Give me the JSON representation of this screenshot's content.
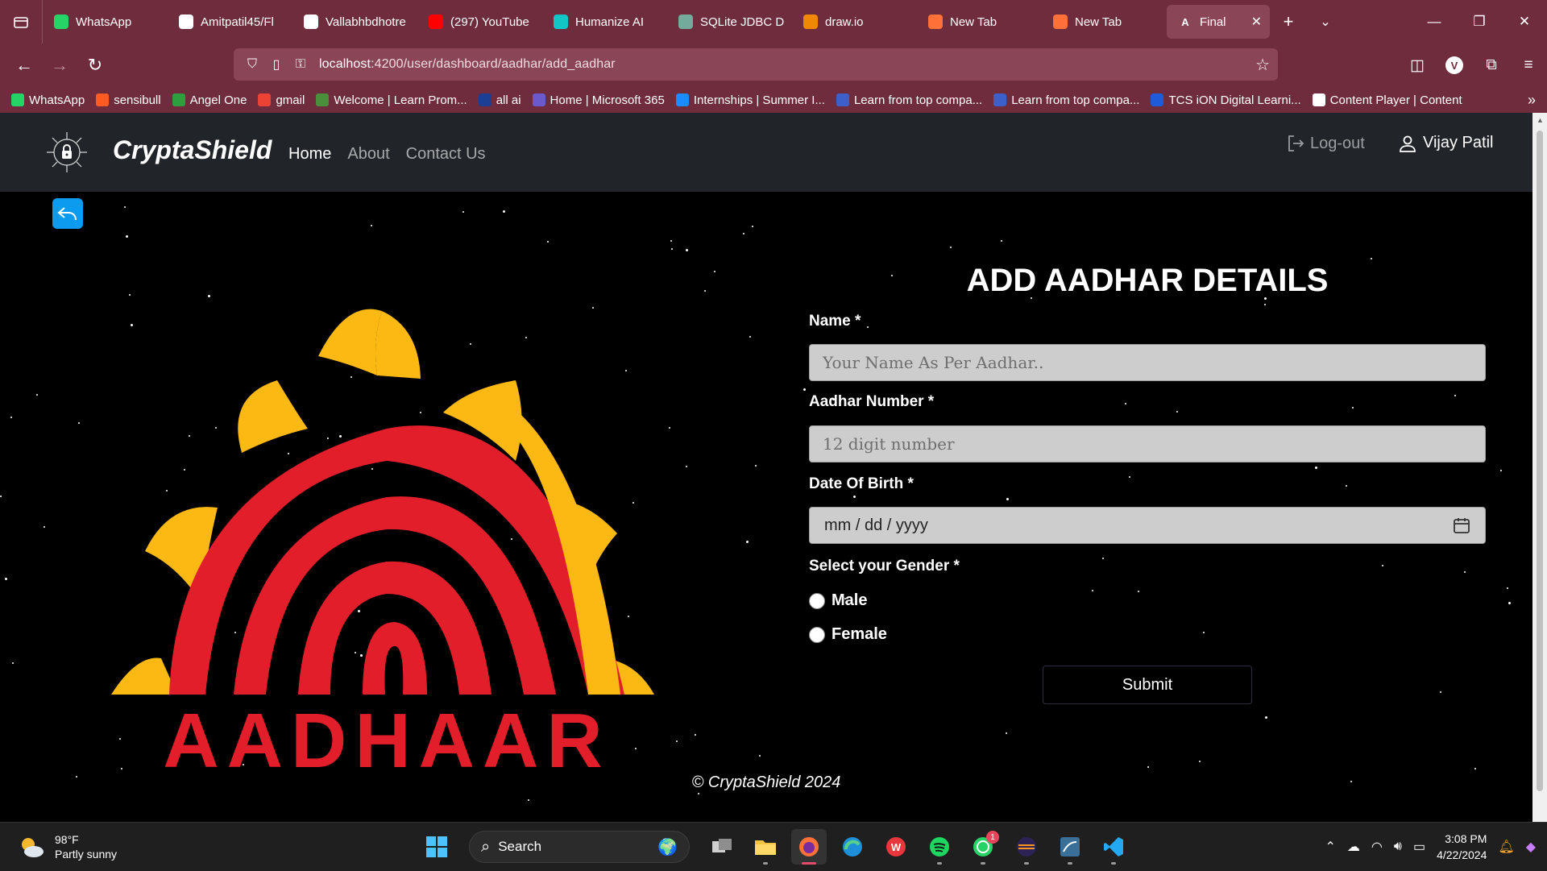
{
  "browser": {
    "tabs": [
      {
        "title": "WhatsApp",
        "icon": "whatsapp-icon",
        "color": "#25d366"
      },
      {
        "title": "Amitpatil45/Fl",
        "icon": "github-icon",
        "color": "#ffffff"
      },
      {
        "title": "Vallabhbdhotre",
        "icon": "github-icon",
        "color": "#ffffff"
      },
      {
        "title": "(297) YouTube",
        "icon": "youtube-icon",
        "color": "#ff0000"
      },
      {
        "title": "Humanize AI",
        "icon": "humanize-ai-icon",
        "color": "#12c6c6"
      },
      {
        "title": "SQLite JDBC Dr",
        "icon": "chatgpt-icon",
        "color": "#74aa9c"
      },
      {
        "title": "draw.io",
        "icon": "drawio-icon",
        "color": "#f08705"
      },
      {
        "title": "New Tab",
        "icon": "firefox-icon",
        "color": "#ff7139"
      },
      {
        "title": "New Tab",
        "icon": "firefox-icon",
        "color": "#ff7139"
      }
    ],
    "active_tab": {
      "title": "Final",
      "icon": "angular-icon"
    },
    "url_host": "localhost",
    "url_path": ":4200/user/dashboard/aadhar/add_aadhar",
    "profile_initial": "V",
    "bookmarks": [
      {
        "label": "WhatsApp",
        "icon": "whatsapp-icon",
        "color": "#25d366"
      },
      {
        "label": "sensibull",
        "icon": "sensibull-icon",
        "color": "#ff5a1f"
      },
      {
        "label": "Angel One",
        "icon": "angel-one-icon",
        "color": "#2e9f3f"
      },
      {
        "label": "gmail",
        "icon": "gmail-icon",
        "color": "#ea4335"
      },
      {
        "label": "Welcome | Learn Prom...",
        "icon": "globe-icon",
        "color": "#4a8f3c"
      },
      {
        "label": "all ai",
        "icon": "all-ai-icon",
        "color": "#1c3f94"
      },
      {
        "label": "Home | Microsoft 365",
        "icon": "microsoft365-icon",
        "color": "#6a5acd"
      },
      {
        "label": "Internships | Summer I...",
        "icon": "internshala-icon",
        "color": "#1a8cff"
      },
      {
        "label": "Learn from top compa...",
        "icon": "shield-icon",
        "color": "#3d5fc9"
      },
      {
        "label": "Learn from top compa...",
        "icon": "shield-icon",
        "color": "#3d5fc9"
      },
      {
        "label": "TCS iON Digital Learni...",
        "icon": "tcs-icon",
        "color": "#1e5bd8"
      },
      {
        "label": "Content Player | Content",
        "icon": "globe-icon",
        "color": "#ffffff"
      }
    ]
  },
  "site": {
    "brand": "CryptaShield",
    "menu": {
      "home": "Home",
      "about": "About",
      "contact": "Contact Us"
    },
    "logout": "Log-out",
    "user_name": "Vijay Patil",
    "logo_text": "AADHAAR",
    "logo_colors": {
      "sun": "#fcb813",
      "fingerprint": "#e31e2b"
    }
  },
  "form": {
    "title": "ADD AADHAR DETAILS",
    "name_label": "Name *",
    "name_placeholder": "Your Name As Per Aadhar..",
    "aadhar_label": "Aadhar Number *",
    "aadhar_placeholder": "12 digit number",
    "dob_label": "Date Of Birth *",
    "dob_placeholder": "mm / dd / yyyy",
    "gender_label": "Select your Gender *",
    "gender_options": [
      "Male",
      "Female"
    ],
    "submit": "Submit"
  },
  "footer": "© CryptaShield 2024",
  "taskbar": {
    "temperature": "98°F",
    "condition": "Partly sunny",
    "search_placeholder": "Search",
    "whatsapp_badge": "1",
    "time": "3:08 PM",
    "date": "4/22/2024"
  }
}
